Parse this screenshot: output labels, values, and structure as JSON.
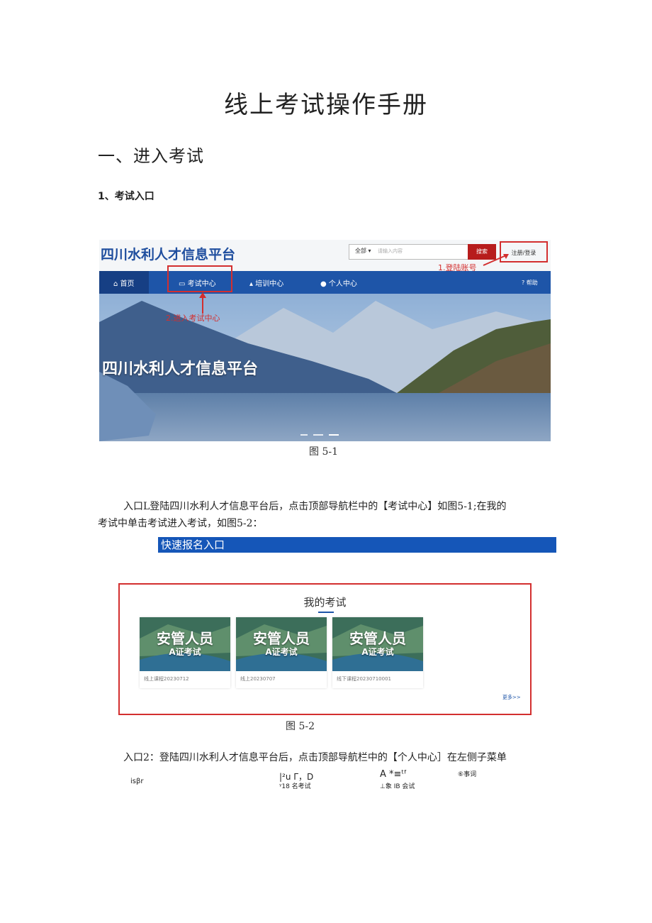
{
  "doc": {
    "title": "线上考试操作手册",
    "section1": "一、进入考试",
    "sub1": "1、考试入口",
    "fig1": {
      "brand": "四川水利人才信息平台",
      "search_scope": "全部 ▾",
      "search_placeholder": "请输入内容",
      "search_button": "搜索",
      "login_button": "注册/登录",
      "annotation_login": "1.登陆账号",
      "nav": [
        "首页",
        "考试中心",
        "培训中心",
        "个人中心",
        "帮助"
      ],
      "annotation_exam": "2.进入考试中心",
      "banner_text": "四川水利人才信息平台",
      "caption": "图 5-1"
    },
    "para1_line1": "入口L登陆四川水利人才信息平台后，点击顶部导航栏中的【考试中心】如图5-1;在我的",
    "para1_line2": "考试中单击考试进入考试，如图5-2：",
    "quick_entry": "快速报名入口",
    "fig2": {
      "title": "我的考试",
      "cards": [
        {
          "t1": "安管人员",
          "t2": "A证考试",
          "sub": "线上课程20230712"
        },
        {
          "t1": "安管人员",
          "t2": "A证考试",
          "sub": "线上20230707"
        },
        {
          "t1": "安管人员",
          "t2": "A证考试",
          "sub": "线下课程20230710001"
        }
      ],
      "more": "更多>>",
      "caption": "图 5-2"
    },
    "para2": "入口2：登陆四川水利人才信息平台后，点击顶部导航栏中的【个人中心］在左侧子菜单",
    "ocr": {
      "a": "isβr",
      "b": "|²u Γ，D",
      "c": "ᵞ18 名考试",
      "d": "A *≡ᵗᶠ",
      "e": "⊥象 IB 会试",
      "f": "⑥事词"
    },
    "colors": {
      "nav_blue": "#1e55a8",
      "annotation_red": "#d32f2f",
      "quick_bar": "#1556b8"
    }
  }
}
